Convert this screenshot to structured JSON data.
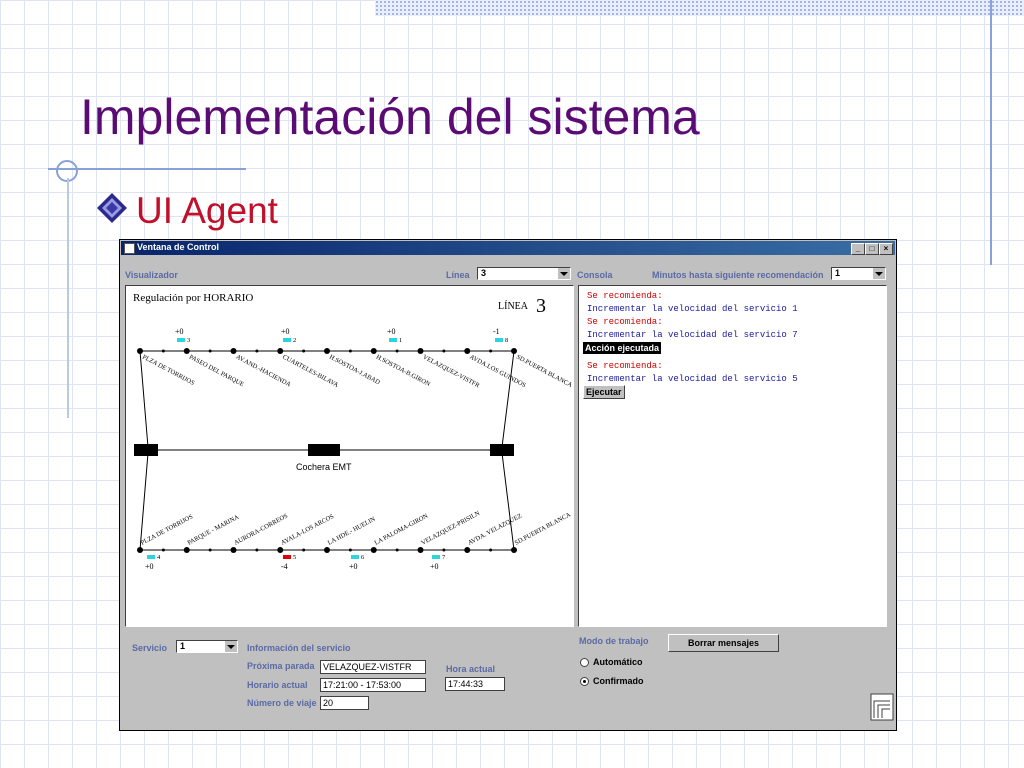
{
  "slide": {
    "title": "Implementación del sistema",
    "bullet": "UI Agent"
  },
  "window": {
    "title": "Ventana de Control",
    "controls": [
      "_",
      "□",
      "×"
    ]
  },
  "visualizador": {
    "label": "Visualizador",
    "linea_label": "Línea",
    "linea_value": "3",
    "regulation_text": "Regulación por HORARIO",
    "linea_caption": "LÍNEA",
    "linea_number": "3",
    "depot_label": "Cochera EMT",
    "top_stops": [
      "PLZA DE TORRIJOS",
      "PASEO DEL PARQUE",
      "AV.AND.-HACIENDA",
      "CUARTELES-BILAVA",
      "H.SOSTOA-J.ABAD",
      "H.SOSTOA-B.GIRON",
      "VELAZQUEZ-VISTFR",
      "AVDA.LOS GUINDOS",
      "SD.PUERTA BLANCA"
    ],
    "bottom_stops": [
      "PLZA DE TORRIJOS",
      "PARQUE - MARINA",
      "AURORA-CORREOS",
      "AYALA-LOS ARCOS",
      "LA HDE.- HUELIN",
      "LA PALOMA-GIRON",
      "VELAZQUEZ-PRISILN",
      "AVDA. VELAZQUEZ",
      "SD.PUERTA BLANCA"
    ],
    "top_buses": [
      {
        "id": "3",
        "offset": "+0",
        "color": "#29d6e0"
      },
      {
        "id": "2",
        "offset": "+0",
        "color": "#29d6e0"
      },
      {
        "id": "1",
        "offset": "+0",
        "color": "#29d6e0"
      },
      {
        "id": "8",
        "offset": "-1",
        "color": "#29d6e0"
      }
    ],
    "bottom_buses": [
      {
        "id": "4",
        "offset": "+0",
        "color": "#29d6e0"
      },
      {
        "id": "5",
        "offset": "-4",
        "color": "#e00000"
      },
      {
        "id": "6",
        "offset": "+0",
        "color": "#29d6e0"
      },
      {
        "id": "7",
        "offset": "+0",
        "color": "#29d6e0"
      }
    ]
  },
  "consola": {
    "label": "Consola",
    "minutos_label": "Minutos hasta siguiente recomendación",
    "minutos_value": "1",
    "lines": [
      {
        "text": "Se recomienda:",
        "color": "red"
      },
      {
        "text": "Incrementar la velocidad del servicio 1",
        "color": "blue"
      },
      {
        "text": "Se recomienda:",
        "color": "red"
      },
      {
        "text": "Incrementar la velocidad del servicio 7",
        "color": "blue"
      },
      {
        "text": "Se recomienda:",
        "color": "red"
      },
      {
        "text": "Incrementar la velocidad del servicio 5",
        "color": "blue"
      }
    ],
    "accion_ejecutada": "Acción ejecutada",
    "ejecutar": "Ejecutar"
  },
  "servicio": {
    "label": "Servicio",
    "value": "1",
    "info_label": "Información del servicio",
    "proxima_parada_label": "Próxima parada",
    "proxima_parada_value": "VELAZQUEZ-VISTFR",
    "horario_actual_label": "Horario actual",
    "horario_actual_value": "17:21:00 - 17:53:00",
    "numero_viaje_label": "Número de viaje",
    "numero_viaje_value": "20",
    "hora_actual_label": "Hora actual",
    "hora_actual_value": "17:44:33"
  },
  "modo": {
    "label": "Modo de trabajo",
    "borrar": "Borrar mensajes",
    "automatico": "Automático",
    "confirmado": "Confirmado",
    "selected": "Confirmado"
  }
}
